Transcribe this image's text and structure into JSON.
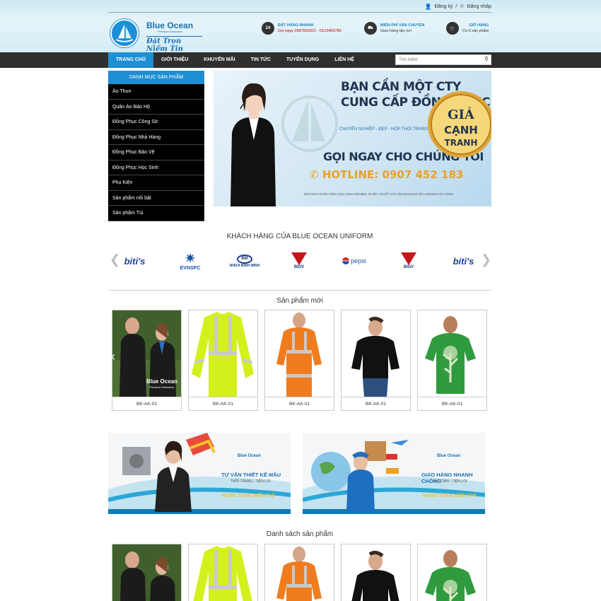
{
  "header": {
    "register": "Đăng ký",
    "separator": "/",
    "login": "Đăng nhập",
    "logo": {
      "name": "Blue Ocean",
      "sub": "Premium Workwear",
      "slogan": "Đặt Trọn Niềm Tin"
    },
    "fast_order": {
      "badge": "24",
      "title": "ĐẶT HÀNG NHANH",
      "text": "Gọi ngay 0987654321 - 0123456789"
    },
    "shipping": {
      "title": "MIỄN PHÍ VẬN CHUYỂN",
      "text": "Giao hàng tận nơi"
    },
    "cart": {
      "title": "GIỎ HÀNG",
      "text": "Có 0 sản phẩm"
    }
  },
  "nav": {
    "items": [
      "TRANG CHỦ",
      "GIỚI THIỆU",
      "KHUYẾN MÃI",
      "TIN TỨC",
      "TUYỂN DỤNG",
      "LIÊN HỆ"
    ],
    "search_placeholder": "Tìm kiếm"
  },
  "sidebar": {
    "title": "DANH MỤC SẢN PHẨM",
    "items": [
      "Áo Thun",
      "Quần Áo Bảo Hộ",
      "Đồng Phục Công Sở",
      "Đồng Phục Nhà Hàng",
      "Đồng Phục Bảo Vệ",
      "Đồng Phục Học Sinh",
      "Phụ Kiện",
      "Sản phẩm nổi bật",
      "Sản phẩm Túi"
    ]
  },
  "banner": {
    "title_line1": "BẠN CẦN MỘT CTY",
    "title_line2": "CUNG CẤP ĐỒNG PHỤC",
    "subtitle": "CHUYÊN NGHIỆP - ĐẸP - HỢP THỜI TRANG",
    "call": "GỌI NGAY CHO CHÚNG TÔI",
    "hotline": "HOTLINE: 0907 452 183",
    "note": "ĐỘI NGŨ NHÂN VIÊN GIÀU KINH NGHIỆM, NHIỆT HUYẾT CỦA BLUEOCEAN SẼ LÀM BẠN HÀI LÒNG",
    "seal_line1": "GIÁ",
    "seal_line2": "CẠNH",
    "seal_line3": "TRANH"
  },
  "customers": {
    "title": "KHÁCH HÀNG CỦA BLUE OCEAN UNIFORM",
    "logos": [
      "biti's",
      "EVNSPC",
      "NHỰA BÌNH MINH",
      "BIDV",
      "pepsi",
      "BIDV",
      "biti's"
    ]
  },
  "new_products": {
    "title": "Sản phẩm mới",
    "items": [
      {
        "code": "BK-AK-01",
        "image_brand": "Blue Ocean",
        "image_sub": "Premium Workwear"
      },
      {
        "code": "BK-AK-01"
      },
      {
        "code": "BK-AK-01"
      },
      {
        "code": "BK-AK-01"
      },
      {
        "code": "BK-AK-01"
      }
    ]
  },
  "promos": [
    {
      "brand": "Blue Ocean",
      "line1": "TƯ VẤN THIẾT KẾ MẪU",
      "line2": "THỜI TRANG - TIỆN LỢI",
      "line3": "HOÀN TOÀN MIỄN PHÍ"
    },
    {
      "brand": "Blue Ocean",
      "line1": "GIAO HÀNG NHANH CHÓNG",
      "line2": "AN TOÀN - TIỆN LỢI",
      "line3": "HOÀN TOÀN MIỄN PHÍ"
    }
  ],
  "product_list": {
    "title": "Danh sách sản phẩm"
  },
  "colors": {
    "accent": "#1d8fd4",
    "nav": "#2f2f2f",
    "sidebar": "#000000"
  }
}
